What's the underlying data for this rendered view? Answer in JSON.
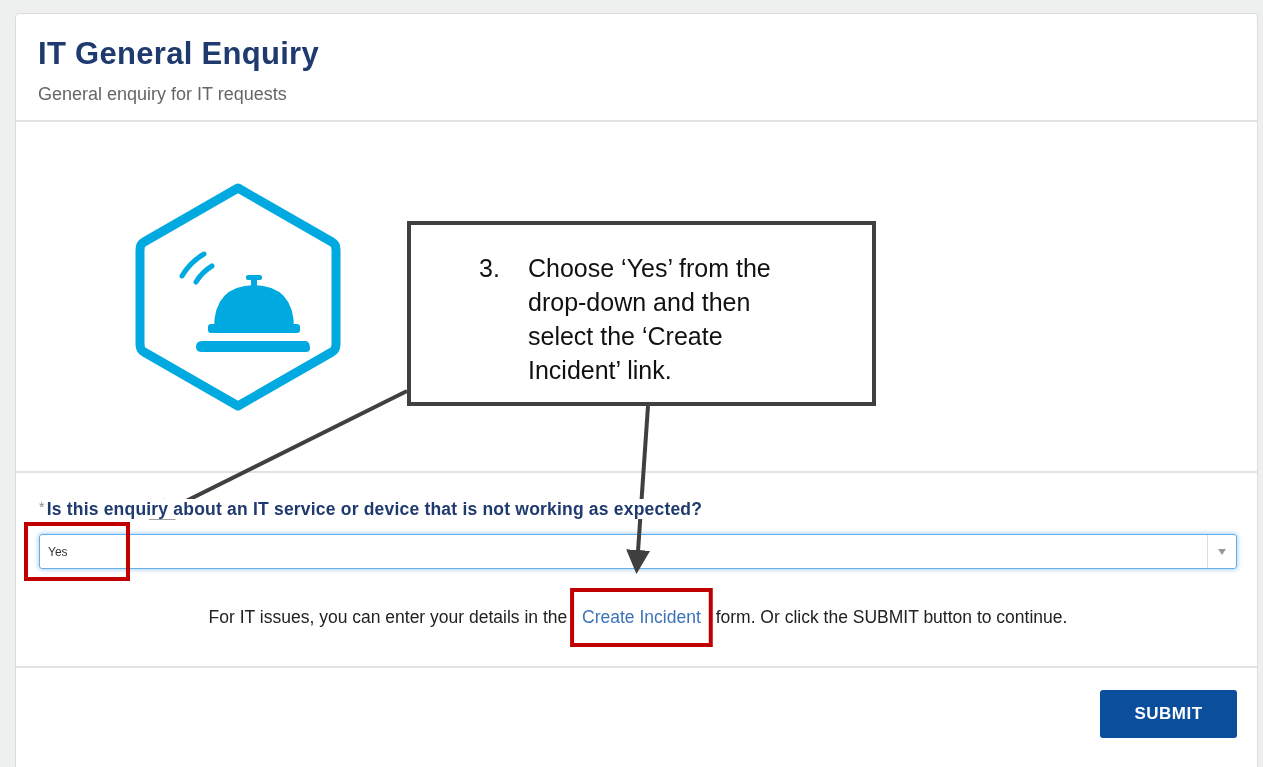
{
  "header": {
    "title": "IT General Enquiry",
    "subtitle": "General enquiry for IT requests"
  },
  "question": {
    "required_mark": "*",
    "label": "Is this enquiry about an IT service or device that is not working as expected?",
    "value": "Yes"
  },
  "info": {
    "text_before": "For IT issues, you can enter your details in the ",
    "link": "Create Incident",
    "text_after": " form. Or click the SUBMIT button to continue."
  },
  "submit": "SUBMIT",
  "callout": {
    "number": "3.",
    "text": "Choose ‘Yes’ from the drop-down and then select the ‘Create Incident’ link."
  }
}
